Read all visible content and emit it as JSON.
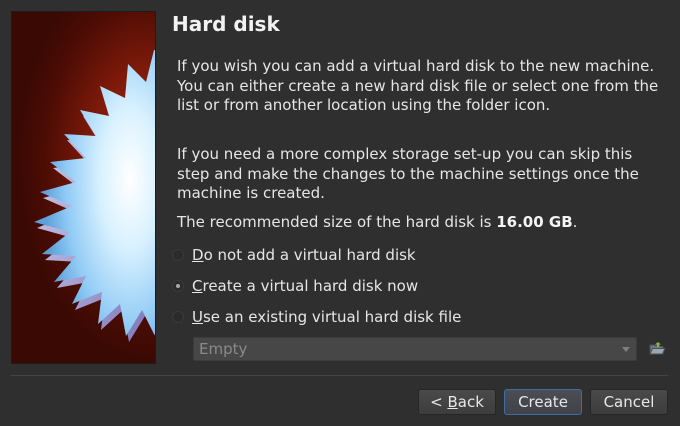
{
  "page": {
    "title": "Hard disk",
    "paragraph_1": "If you wish you can add a virtual hard disk to the new machine. You can either create a new hard disk file or select one from the list or from another location using the folder icon.",
    "paragraph_2": "If you need a more complex storage set-up you can skip this step and make the changes to the machine settings once the machine is created.",
    "recommended_prefix": "The recommended size of the hard disk is ",
    "recommended_size": "16.00 GB",
    "recommended_suffix": "."
  },
  "options": [
    {
      "mnemonic": "D",
      "rest": "o not add a virtual hard disk",
      "checked": false
    },
    {
      "mnemonic": "C",
      "rest": "reate a virtual hard disk now",
      "checked": true
    },
    {
      "mnemonic": "U",
      "rest": "se an existing virtual hard disk file",
      "checked": false
    }
  ],
  "disk_select": {
    "value": "Empty",
    "enabled": false
  },
  "icons": {
    "banner": "starburst-disk-banner-icon",
    "folder": "folder-open-icon"
  },
  "buttons": {
    "back_prefix": "< ",
    "back_mnemonic": "B",
    "back_rest": "ack",
    "create": "Create",
    "cancel": "Cancel"
  },
  "colors": {
    "background": "#2f2f2f",
    "banner_red": "#7e1a0a",
    "starburst_light": "#bfe6ff",
    "focus_border": "#3d6fa5"
  }
}
